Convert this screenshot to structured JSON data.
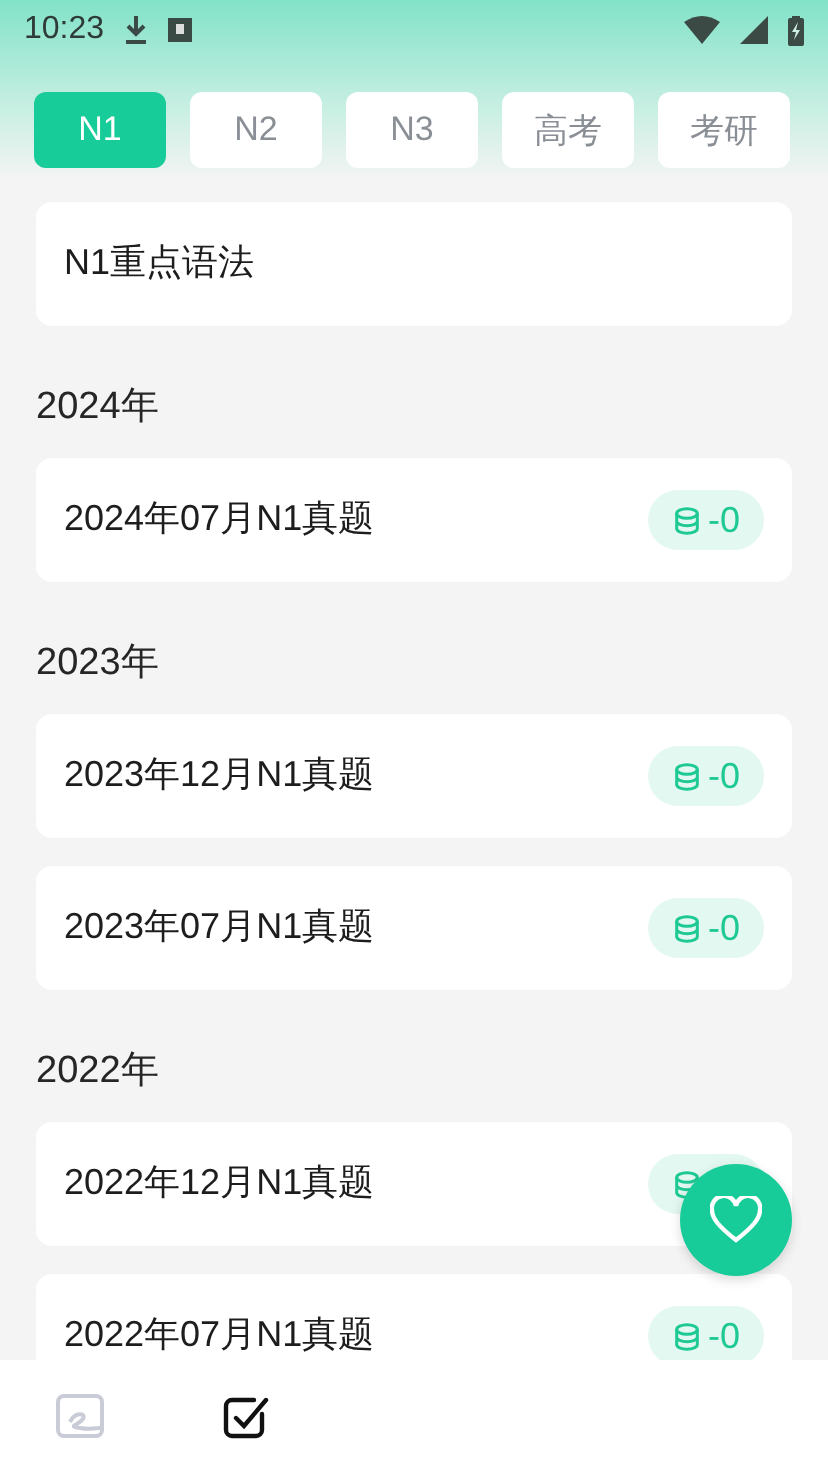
{
  "status_bar": {
    "time": "10:23"
  },
  "tabs": [
    {
      "label": "N1",
      "selected": true
    },
    {
      "label": "N2",
      "selected": false
    },
    {
      "label": "N3",
      "selected": false
    },
    {
      "label": "高考",
      "selected": false
    },
    {
      "label": "考研",
      "selected": false
    }
  ],
  "grammar_card": {
    "title": "N1重点语法"
  },
  "sections": [
    {
      "year": "2024年",
      "items": [
        {
          "title": "2024年07月N1真题",
          "badge": "-0"
        }
      ]
    },
    {
      "year": "2023年",
      "items": [
        {
          "title": "2023年12月N1真题",
          "badge": "-0"
        },
        {
          "title": "2023年07月N1真题",
          "badge": "-0"
        }
      ]
    },
    {
      "year": "2022年",
      "items": [
        {
          "title": "2022年12月N1真题"
        },
        {
          "title": "2022年07月N1真题",
          "badge": "-0"
        }
      ]
    }
  ],
  "bottom_nav": [
    {
      "kind": "picture",
      "selected": false
    },
    {
      "kind": "check",
      "selected": true
    }
  ]
}
